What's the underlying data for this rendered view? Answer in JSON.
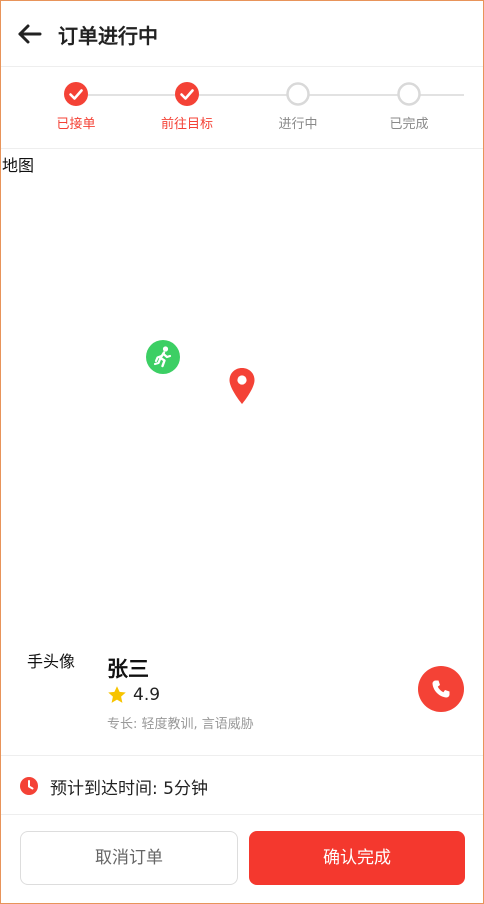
{
  "header": {
    "title": "订单进行中",
    "back_icon": "arrow-left-icon"
  },
  "stepper": {
    "steps": [
      {
        "label": "已接单",
        "status": "done"
      },
      {
        "label": "前往目标",
        "status": "done"
      },
      {
        "label": "进行中",
        "status": "todo"
      },
      {
        "label": "已完成",
        "status": "todo"
      }
    ],
    "done_color": "#f44236",
    "todo_color": "#d9d9d9"
  },
  "map": {
    "label": "地图",
    "markers": [
      {
        "type": "runner",
        "icon": "running-person-icon",
        "color": "#3ccf64"
      },
      {
        "type": "destination",
        "icon": "map-pin-icon",
        "color": "#f44236"
      }
    ]
  },
  "driver": {
    "avatar_text": "手头像",
    "name": "张三",
    "rating": "4.9",
    "star_icon": "star-icon",
    "specialty": "专长: 轻度教训, 言语威胁",
    "call_icon": "phone-icon"
  },
  "eta": {
    "icon": "clock-icon",
    "text": "预计到达时间: 5分钟"
  },
  "actions": {
    "cancel_label": "取消订单",
    "confirm_label": "确认完成"
  },
  "colors": {
    "accent": "#f44236",
    "success": "#3ccf64",
    "star": "#f7c400"
  }
}
